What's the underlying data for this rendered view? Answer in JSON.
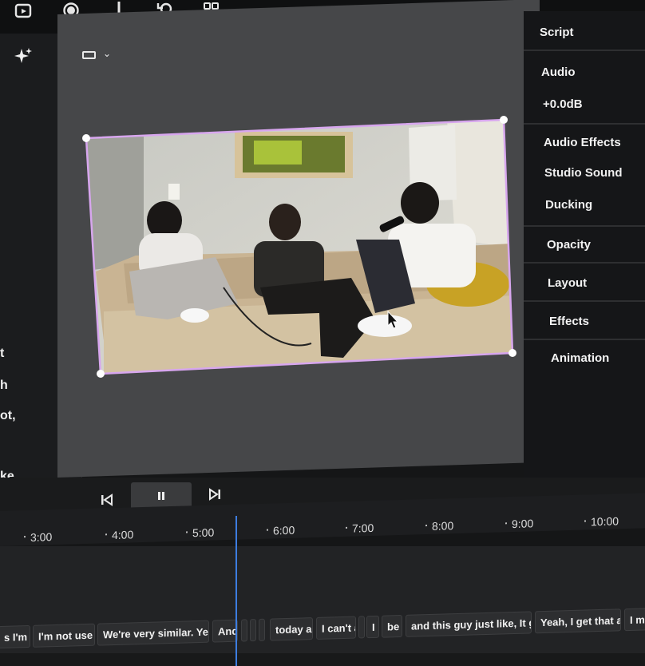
{
  "toolbar": {
    "icons": [
      "clip-icon",
      "record-icon",
      "text-cursor-icon",
      "cycle-icon",
      "grid-icon"
    ]
  },
  "left_panel": {
    "icon": "sparkle-icon",
    "script_fragments": [
      "t",
      "h",
      "ot,",
      "ke."
    ]
  },
  "canvas": {
    "aspect_icon": "aspect-ratio-icon",
    "aspect_chevron": "⌄"
  },
  "right_panel": {
    "script_label": "Script",
    "audio_label": "Audio",
    "audio_value": "+0.0dB",
    "audio_effects_label": "Audio Effects",
    "studio_sound_label": "Studio Sound",
    "ducking_label": "Ducking",
    "opacity_label": "Opacity",
    "layout_label": "Layout",
    "effects_label": "Effects",
    "animation_label": "Animation"
  },
  "transport": {
    "prev_icon": "skip-back-icon",
    "pause_icon": "pause-icon",
    "next_icon": "skip-forward-icon"
  },
  "ruler": {
    "ticks": [
      "3:00",
      "4:00",
      "5:00",
      "6:00",
      "7:00",
      "8:00",
      "9:00",
      "10:00"
    ]
  },
  "captions": [
    "s I'm j",
    "I'm not use",
    "We're very similar. Ye",
    "And",
    "today a",
    "I can't a",
    "I",
    "be",
    "and this guy just like, It g",
    "Yeah, I get that a",
    "I me"
  ],
  "colors": {
    "selection_border": "#d7a6ee",
    "playhead": "#3d7de0",
    "canvas_bg": "#464749",
    "panel_bg": "#151618"
  }
}
